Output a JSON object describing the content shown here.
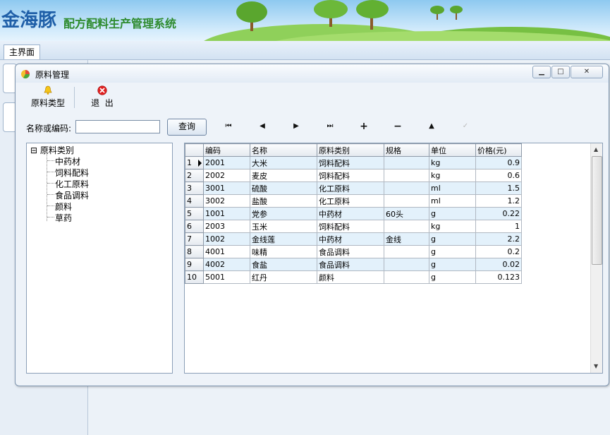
{
  "app": {
    "brand": "金海豚",
    "subtitle": "配方配料生产管理系统"
  },
  "tabs": [
    {
      "label": "主界面"
    }
  ],
  "window": {
    "title": "原料管理",
    "controls": {
      "minimize": "minimize-icon",
      "maximize": "maximize-icon",
      "close": "close-icon"
    }
  },
  "toolbar": {
    "category_label": "原料类型",
    "category_icon": "bell-icon",
    "exit_label": "退  出",
    "exit_icon": "close-circle-icon"
  },
  "search": {
    "label": "名称或编码:",
    "value": "",
    "placeholder": "",
    "button_label": "查询"
  },
  "nav": {
    "first": "first-record-icon",
    "prev": "previous-record-icon",
    "next": "next-record-icon",
    "last": "last-record-icon",
    "add": "add-record-icon",
    "delete": "delete-record-icon",
    "edit": "edit-record-icon",
    "post": "post-record-icon"
  },
  "tree": {
    "root": "原料类别",
    "expander": "⊟",
    "children": [
      "中药材",
      "饲料配料",
      "化工原料",
      "食品调料",
      "颜料",
      "草药"
    ]
  },
  "grid": {
    "columns": [
      "编码",
      "名称",
      "原料类别",
      "规格",
      "单位",
      "价格(元)"
    ],
    "rows": [
      {
        "n": "1",
        "code": "2001",
        "name": "大米",
        "cat": "饲料配料",
        "spec": "",
        "unit": "kg",
        "price": "0.9"
      },
      {
        "n": "2",
        "code": "2002",
        "name": "麦皮",
        "cat": "饲料配料",
        "spec": "",
        "unit": "kg",
        "price": "0.6"
      },
      {
        "n": "3",
        "code": "3001",
        "name": "硫酸",
        "cat": "化工原料",
        "spec": "",
        "unit": "ml",
        "price": "1.5"
      },
      {
        "n": "4",
        "code": "3002",
        "name": "盐酸",
        "cat": "化工原料",
        "spec": "",
        "unit": "ml",
        "price": "1.2"
      },
      {
        "n": "5",
        "code": "1001",
        "name": "党参",
        "cat": "中药材",
        "spec": "60头",
        "unit": "g",
        "price": "0.22"
      },
      {
        "n": "6",
        "code": "2003",
        "name": "玉米",
        "cat": "饲料配料",
        "spec": "",
        "unit": "kg",
        "price": "1"
      },
      {
        "n": "7",
        "code": "1002",
        "name": "金线莲",
        "cat": "中药材",
        "spec": "金线",
        "unit": "g",
        "price": "2.2"
      },
      {
        "n": "8",
        "code": "4001",
        "name": "味精",
        "cat": "食品调料",
        "spec": "",
        "unit": "g",
        "price": "0.2"
      },
      {
        "n": "9",
        "code": "4002",
        "name": "食盐",
        "cat": "食品调料",
        "spec": "",
        "unit": "g",
        "price": "0.02"
      },
      {
        "n": "10",
        "code": "5001",
        "name": "红丹",
        "cat": "颜料",
        "spec": "",
        "unit": "g",
        "price": "0.123"
      }
    ],
    "current_row": 1
  },
  "colors": {
    "brand": "#1f5fa8",
    "subtitle": "#2e8b2e",
    "row_alt": "#e3f1fb",
    "window_border": "#7f96b0"
  }
}
